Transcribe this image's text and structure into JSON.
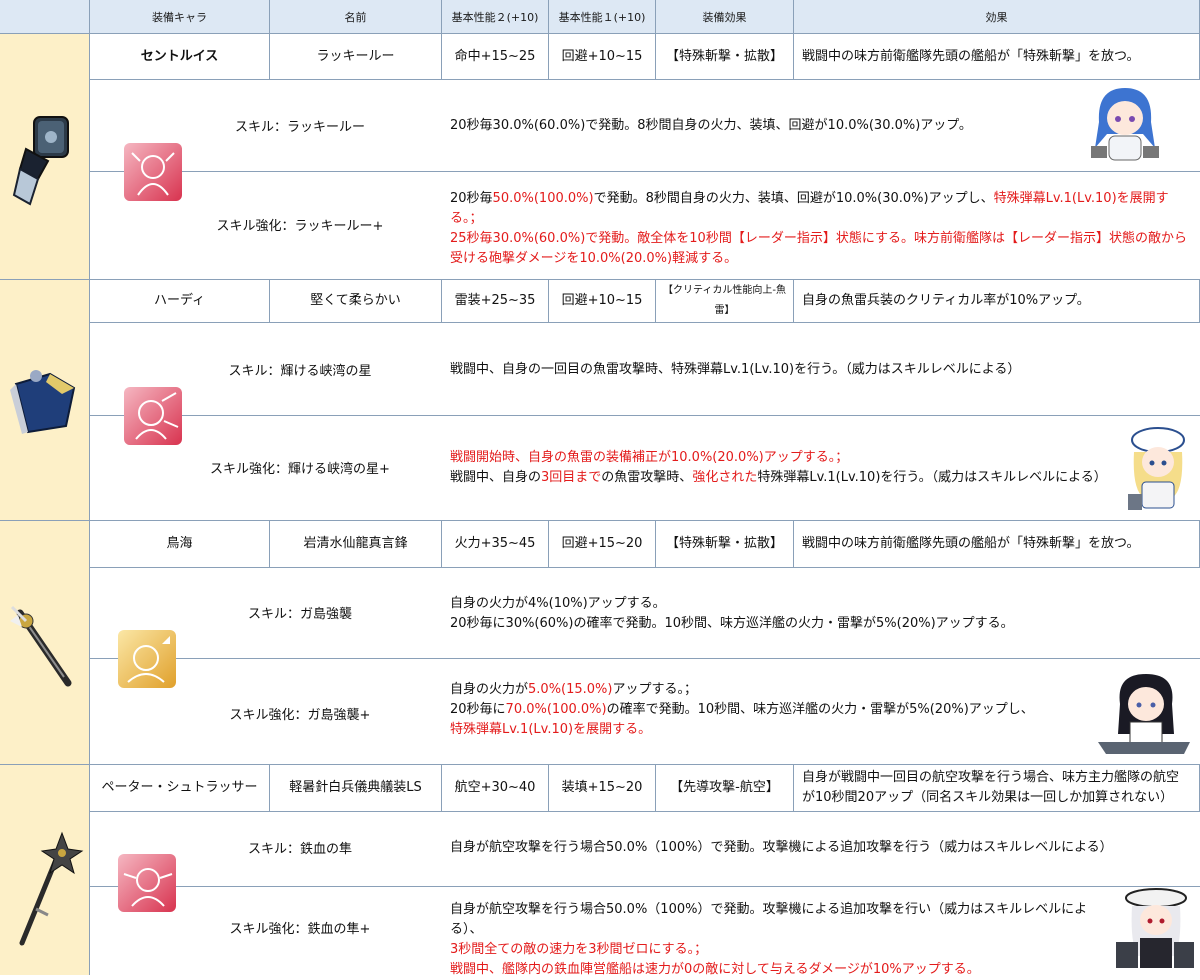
{
  "headers": [
    "装備キャラ",
    "名前",
    "基本性能２(+10)",
    "基本性能１(+10)",
    "装備効果",
    "効果"
  ],
  "rows": [
    {
      "character": "セントルイス",
      "name": "ラッキールー",
      "stat2": "命中+15~25",
      "stat1": "回避+10~15",
      "equip_effect": "【特殊斬撃・拡散】",
      "effect": "戦闘中の味方前衛艦隊先頭の艦船が「特殊斬撃」を放つ。",
      "skill_label": "スキル：ラッキールー",
      "skill_desc": "20秒毎30.0%(60.0%)で発動。8秒間自身の火力、装填、回避が10.0%(30.0%)アップ。",
      "skillplus_label": "スキル強化：ラッキールー+",
      "sp1a": "20秒毎",
      "sp1b": "50.0%(100.0%)",
      "sp1c": "で発動。8秒間自身の火力、装填、回避が10.0%(30.0%)アップし、",
      "sp1d": "特殊弾幕Lv.1(Lv.10)を展開する。；",
      "sp2": "25秒毎30.0%(60.0%)で発動。敵全体を10秒間【レーダー指示】状態にする。味方前衛艦隊は【レーダー指示】状態の敵から",
      "sp3": "受ける砲撃ダメージを10.0%(20.0%)軽減する。"
    },
    {
      "character": "ハーディ",
      "name": "堅くて柔らかい",
      "stat2": "雷装+25~35",
      "stat1": "回避+10~15",
      "equip_effect": "【クリティカル性能向上-魚雷】",
      "effect": "自身の魚雷兵装のクリティカル率が10%アップ。",
      "skill_label": "スキル：輝ける峡湾の星",
      "skill_desc": "戦闘中、自身の一回目の魚雷攻撃時、特殊弾幕Lv.1(Lv.10)を行う。（威力はスキルレベルによる）",
      "skillplus_label": "スキル強化：輝ける峡湾の星+",
      "sp1": "戦闘開始時、自身の魚雷の装備補正が10.0%(20.0%)アップする。；",
      "sp2a": "戦闘中、自身の",
      "sp2b": "3回目まで",
      "sp2c": "の魚雷攻撃時、",
      "sp2d": "強化された",
      "sp2e": "特殊弾幕Lv.1(Lv.10)を行う。（威力はスキルレベルによる）"
    },
    {
      "character": "鳥海",
      "name": "岩清水仙龍真言鋒",
      "stat2": "火力+35~45",
      "stat1": "回避+15~20",
      "equip_effect": "【特殊斬撃・拡散】",
      "effect": "戦闘中の味方前衛艦隊先頭の艦船が「特殊斬撃」を放つ。",
      "skill_label": "スキル：ガ島強襲",
      "skill_desc1": "自身の火力が4%(10%)アップする。",
      "skill_desc2": "20秒毎に30%(60%)の確率で発動。10秒間、味方巡洋艦の火力・雷撃が5%(20%)アップする。",
      "skillplus_label": "スキル強化：ガ島強襲+",
      "sp1a": "自身の火力が",
      "sp1b": "5.0%(15.0%)",
      "sp1c": "アップする。；",
      "sp2a": "20秒毎に",
      "sp2b": "70.0%(100.0%)",
      "sp2c": "の確率で発動。10秒間、味方巡洋艦の火力・雷撃が5%(20%)アップし、",
      "sp3": "特殊弾幕Lv.1(Lv.10)を展開する。"
    },
    {
      "character": "ペーター・シュトラッサー",
      "name": "軽暑針白兵儀典艤装LS",
      "stat2": "航空+30~40",
      "stat1": "装填+15~20",
      "equip_effect": "【先導攻撃-航空】",
      "effect1": "自身が戦闘中一回目の航空攻撃を行う場合、味方主力艦隊の航空",
      "effect2": "が10秒間20アップ（同名スキル効果は一回しか加算されない）",
      "skill_label": "スキル：鉄血の隼",
      "skill_desc": "自身が航空攻撃を行う場合50.0%（100%）で発動。攻撃機による追加攻撃を行う（威力はスキルレベルによる）",
      "skillplus_label": "スキル強化：鉄血の隼+",
      "sp1": "自身が航空攻撃を行う場合50.0%（100%）で発動。攻撃機による追加攻撃を行い（威力はスキルレベルによる）、",
      "sp2": "3秒間全ての敵の速力を3秒間ゼロにする。；",
      "sp3": "戦闘中、艦隊内の鉄血陣営艦船は速力が0の敵に対して与えるダメージが10%アップする。"
    }
  ],
  "colors": {
    "header_bg": "#dde8f4",
    "side_bg": "#fdf0c8",
    "border": "#8aa0b8",
    "highlight_red": "#e31b1b"
  }
}
